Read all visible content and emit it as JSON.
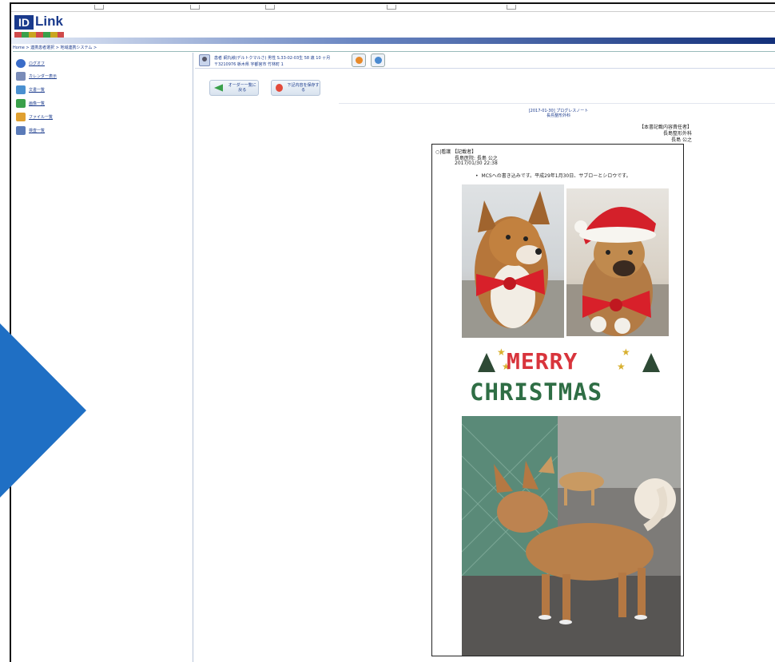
{
  "app": {
    "logo_id": "ID",
    "logo_name": "Link"
  },
  "breadcrumb": "Home > 連携患者選択 > 地域連携システム >",
  "sidebar": {
    "items": [
      {
        "label": "ログオフ",
        "icon": "logout-icon",
        "color": "#3a6cc8"
      },
      {
        "label": "カレンダー表示",
        "icon": "calendar-icon",
        "color": "#7a8cb8"
      },
      {
        "label": "文書一覧",
        "icon": "document-icon",
        "color": "#4a90d0"
      },
      {
        "label": "画像一覧",
        "icon": "image-icon",
        "color": "#3aa04a"
      },
      {
        "label": "ファイル一覧",
        "icon": "folder-icon",
        "color": "#e0a030"
      },
      {
        "label": "検査一覧",
        "icon": "lab-icon",
        "color": "#5a7ab8"
      }
    ]
  },
  "patient": {
    "line1": "患者 綱丸様(デルトクマルさ) 男性 S.33-02-03生 58 歳 10 ヶ月",
    "line2": "〒3210976 栃木県 宇都宮市 竹林町 1"
  },
  "actions": {
    "back_label": "オーダー一覧に戻る",
    "save_label": "下記内容を保存する"
  },
  "report": {
    "title_line1": "[2017-01-30] プログレスノート",
    "title_line2": "長島整形外科",
    "responsible_label": "【本書記載内容責任者】",
    "responsible_dept": "長島整形外科",
    "responsible_name": "長島 公之"
  },
  "note": {
    "header": "○|看護 【記載者】",
    "author": "長島医院: 長島 公之",
    "datetime": "2017/01/30 22:38",
    "body": "MCSへの書き込みです。平成29年1月30日、サブローとシロウです。",
    "xmas_line1": "MERRY",
    "xmas_line2": "CHRISTMAS"
  },
  "colors": {
    "brand_navy": "#13307a",
    "link_blue": "#1a3a8c",
    "overlay_blue": "#1f6fc4"
  }
}
